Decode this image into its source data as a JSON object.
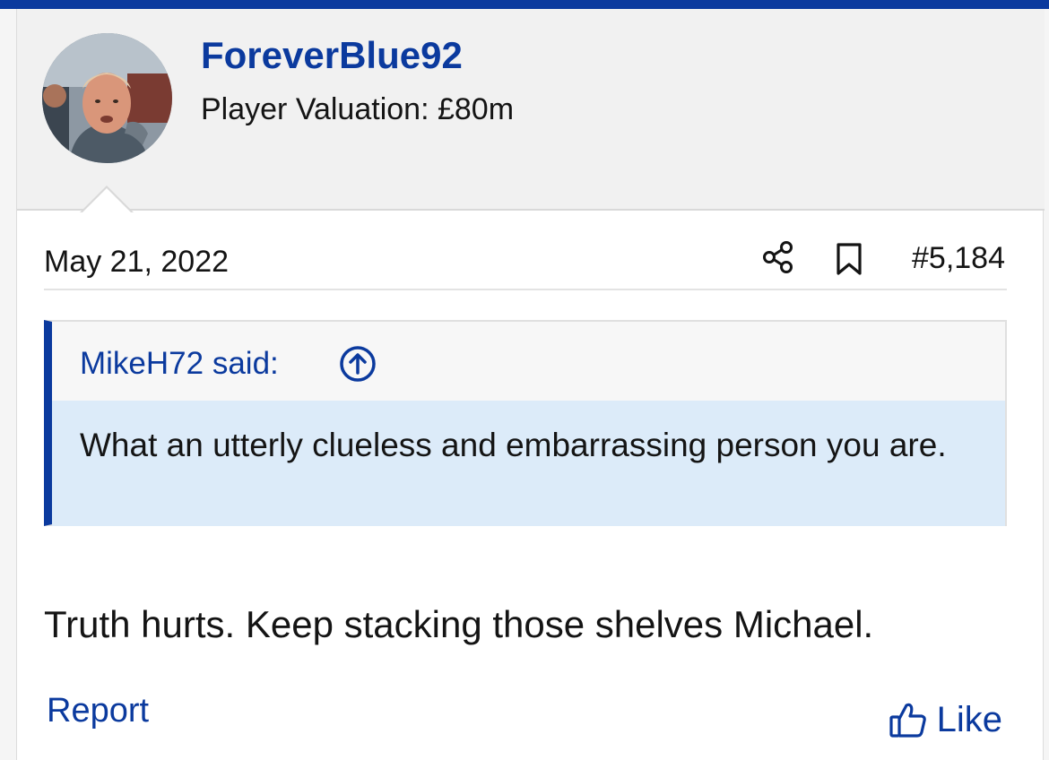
{
  "colors": {
    "accent": "#0b3a9e",
    "quote_body_bg": "#dcebf9",
    "header_bg": "#f1f1f1"
  },
  "author": {
    "username": "ForeverBlue92",
    "user_title": "Player Valuation: £80m",
    "avatar": "avatar-photo"
  },
  "meta": {
    "date": "May 21, 2022",
    "share_icon": "share-icon",
    "bookmark_icon": "bookmark-icon",
    "post_number": "#5,184"
  },
  "quote": {
    "author_label": "MikeH72 said:",
    "jump_icon": "arrow-up-circle-icon",
    "text": "What an utterly clueless and embarrassing person you are."
  },
  "message": {
    "text": "Truth hurts. Keep stacking those shelves Michael."
  },
  "actions": {
    "report_label": "Report",
    "like_icon": "thumbs-up-icon",
    "like_label": "Like"
  }
}
